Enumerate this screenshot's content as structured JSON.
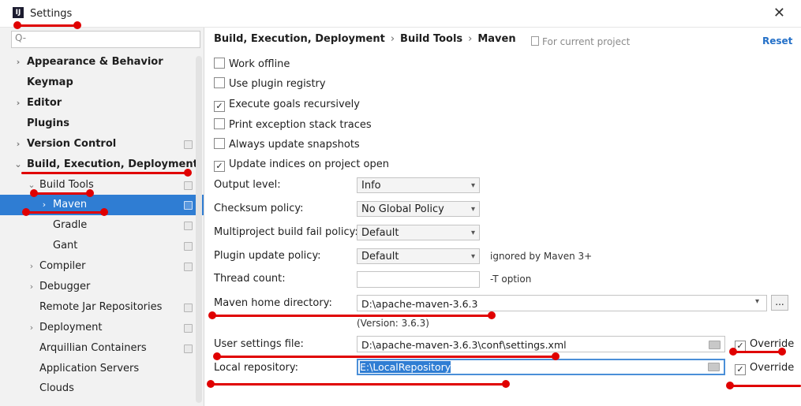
{
  "window": {
    "title": "Settings",
    "close": "✕"
  },
  "sidebar": {
    "search_placeholder": "Q-",
    "items": [
      {
        "label": "Appearance & Behavior",
        "chevron": "›"
      },
      {
        "label": "Keymap",
        "chevron": ""
      },
      {
        "label": "Editor",
        "chevron": "›"
      },
      {
        "label": "Plugins",
        "chevron": ""
      },
      {
        "label": "Version Control",
        "chevron": "›"
      },
      {
        "label": "Build, Execution, Deployment",
        "chevron": "⌄"
      },
      {
        "label": "Build Tools",
        "chevron": "⌄"
      },
      {
        "label": "Maven",
        "chevron": "›"
      },
      {
        "label": "Gradle",
        "chevron": ""
      },
      {
        "label": "Gant",
        "chevron": ""
      },
      {
        "label": "Compiler",
        "chevron": "›"
      },
      {
        "label": "Debugger",
        "chevron": "›"
      },
      {
        "label": "Remote Jar Repositories",
        "chevron": ""
      },
      {
        "label": "Deployment",
        "chevron": "›"
      },
      {
        "label": "Arquillian Containers",
        "chevron": ""
      },
      {
        "label": "Application Servers",
        "chevron": ""
      },
      {
        "label": "Clouds",
        "chevron": ""
      }
    ]
  },
  "breadcrumb": [
    "Build, Execution, Deployment",
    "Build Tools",
    "Maven"
  ],
  "breadcrumb_sep": "›",
  "for_current_project": "For current project",
  "reset": "Reset",
  "checkboxes": [
    {
      "label": "Work offline",
      "checked": false
    },
    {
      "label": "Use plugin registry",
      "checked": false
    },
    {
      "label": "Execute goals recursively",
      "checked": true
    },
    {
      "label": "Print exception stack traces",
      "checked": false
    },
    {
      "label": "Always update snapshots",
      "checked": false
    },
    {
      "label": "Update indices on project open",
      "checked": true
    }
  ],
  "fields": {
    "output_level": {
      "label": "Output level:",
      "value": "Info"
    },
    "checksum_policy": {
      "label": "Checksum policy:",
      "value": "No Global Policy"
    },
    "multiproject_fail": {
      "label": "Multiproject build fail policy:",
      "value": "Default"
    },
    "plugin_update": {
      "label": "Plugin update policy:",
      "value": "Default",
      "hint": "ignored by Maven 3+"
    },
    "thread_count": {
      "label": "Thread count:",
      "value": "",
      "hint": "-T option"
    },
    "maven_home": {
      "label": "Maven home directory:",
      "value": "D:\\apache-maven-3.6.3",
      "version": "(Version: 3.6.3)",
      "browse": "..."
    },
    "user_settings": {
      "label": "User settings file:",
      "value": "D:\\apache-maven-3.6.3\\conf\\settings.xml",
      "override": "Override",
      "override_checked": true
    },
    "local_repo": {
      "label": "Local repository:",
      "value": "E:\\LocalRepository",
      "override": "Override",
      "override_checked": true
    }
  },
  "colors": {
    "selection": "#2f7dd3",
    "link": "#2470c8",
    "annotation": "#e00000"
  }
}
